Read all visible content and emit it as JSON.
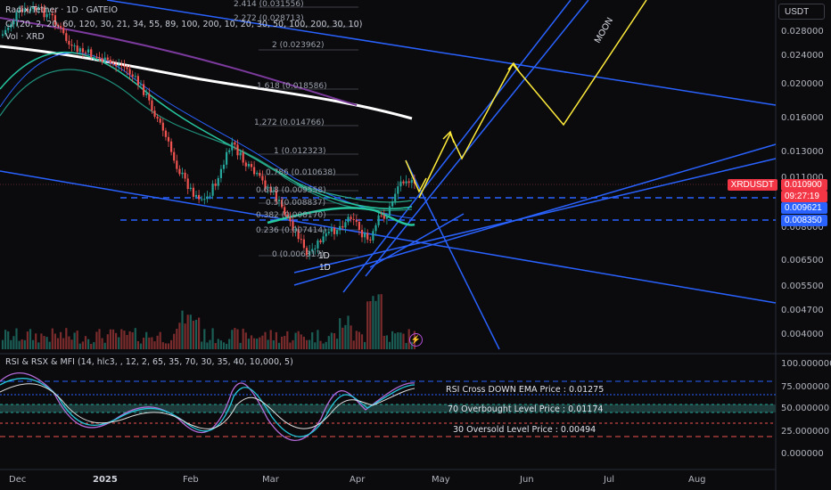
{
  "header": {
    "title": "Radix/Tether · 1D · GATEIO",
    "indicator1": "Cl (20, 2, 20, 60, 120, 30, 21, 34, 55, 89, 100, 200, 10, 20, 30, 50, 100, 200, 30, 10)",
    "indicator2": "Vol · XRD"
  },
  "axis_unit": "USDT",
  "price_axis": [
    "0.028000",
    "0.024000",
    "0.020000",
    "0.016000",
    "0.013000",
    "0.011000",
    "0.008000",
    "0.006500",
    "0.005500",
    "0.004700",
    "0.004000"
  ],
  "price_tags": {
    "symbol": "XRDUSDT",
    "last": "0.010900",
    "countdown": "09:27:19",
    "level1": "0.009621",
    "level2": "0.008350"
  },
  "fib_levels": [
    "2.414 (0.031556)",
    "2.272 (0.028713)",
    "2 (0.023962)",
    "1.618 (0.018586)",
    "1.272 (0.014766)",
    "1 (0.012323)",
    "0.786 (0.010638)",
    "0.618 (0.009558)",
    "0.5 (0.008837)",
    "0.382 (0.008170)",
    "0.236 (0.007414)",
    "0 (0.006317)"
  ],
  "annotations": {
    "moon": "MOON",
    "tf1": "1D",
    "tf2": "1D"
  },
  "rsi": {
    "title": "RSI & RSX & MFI (14, hlc3, , 12, 2, 65, 35, 70, 30, 35, 40, 10,000, 5)",
    "axis": [
      "100.000000",
      "75.000000",
      "50.000000",
      "25.000000",
      "0.000000"
    ],
    "cross_note": "RSI Cross DOWN EMA Price : 0.01275",
    "overbought_note": "70 Overbought Level Price : 0.01174",
    "oversold_note": "30 Oversold Level Price : 0.00494"
  },
  "time_axis": [
    "Dec",
    "2025",
    "Feb",
    "Mar",
    "Apr",
    "May",
    "Jun",
    "Jul",
    "Aug"
  ],
  "colors": {
    "up": "#26a69a",
    "down": "#ef5350",
    "trendline": "#2962ff",
    "arrow": "#ffeb3b",
    "ma_white": "#ffffff",
    "ma_purple": "#9c27b0",
    "ma_teal": "#26c6a0",
    "rsi_line": "#b36bd8"
  },
  "icons": {
    "alert": "lightning-icon"
  }
}
